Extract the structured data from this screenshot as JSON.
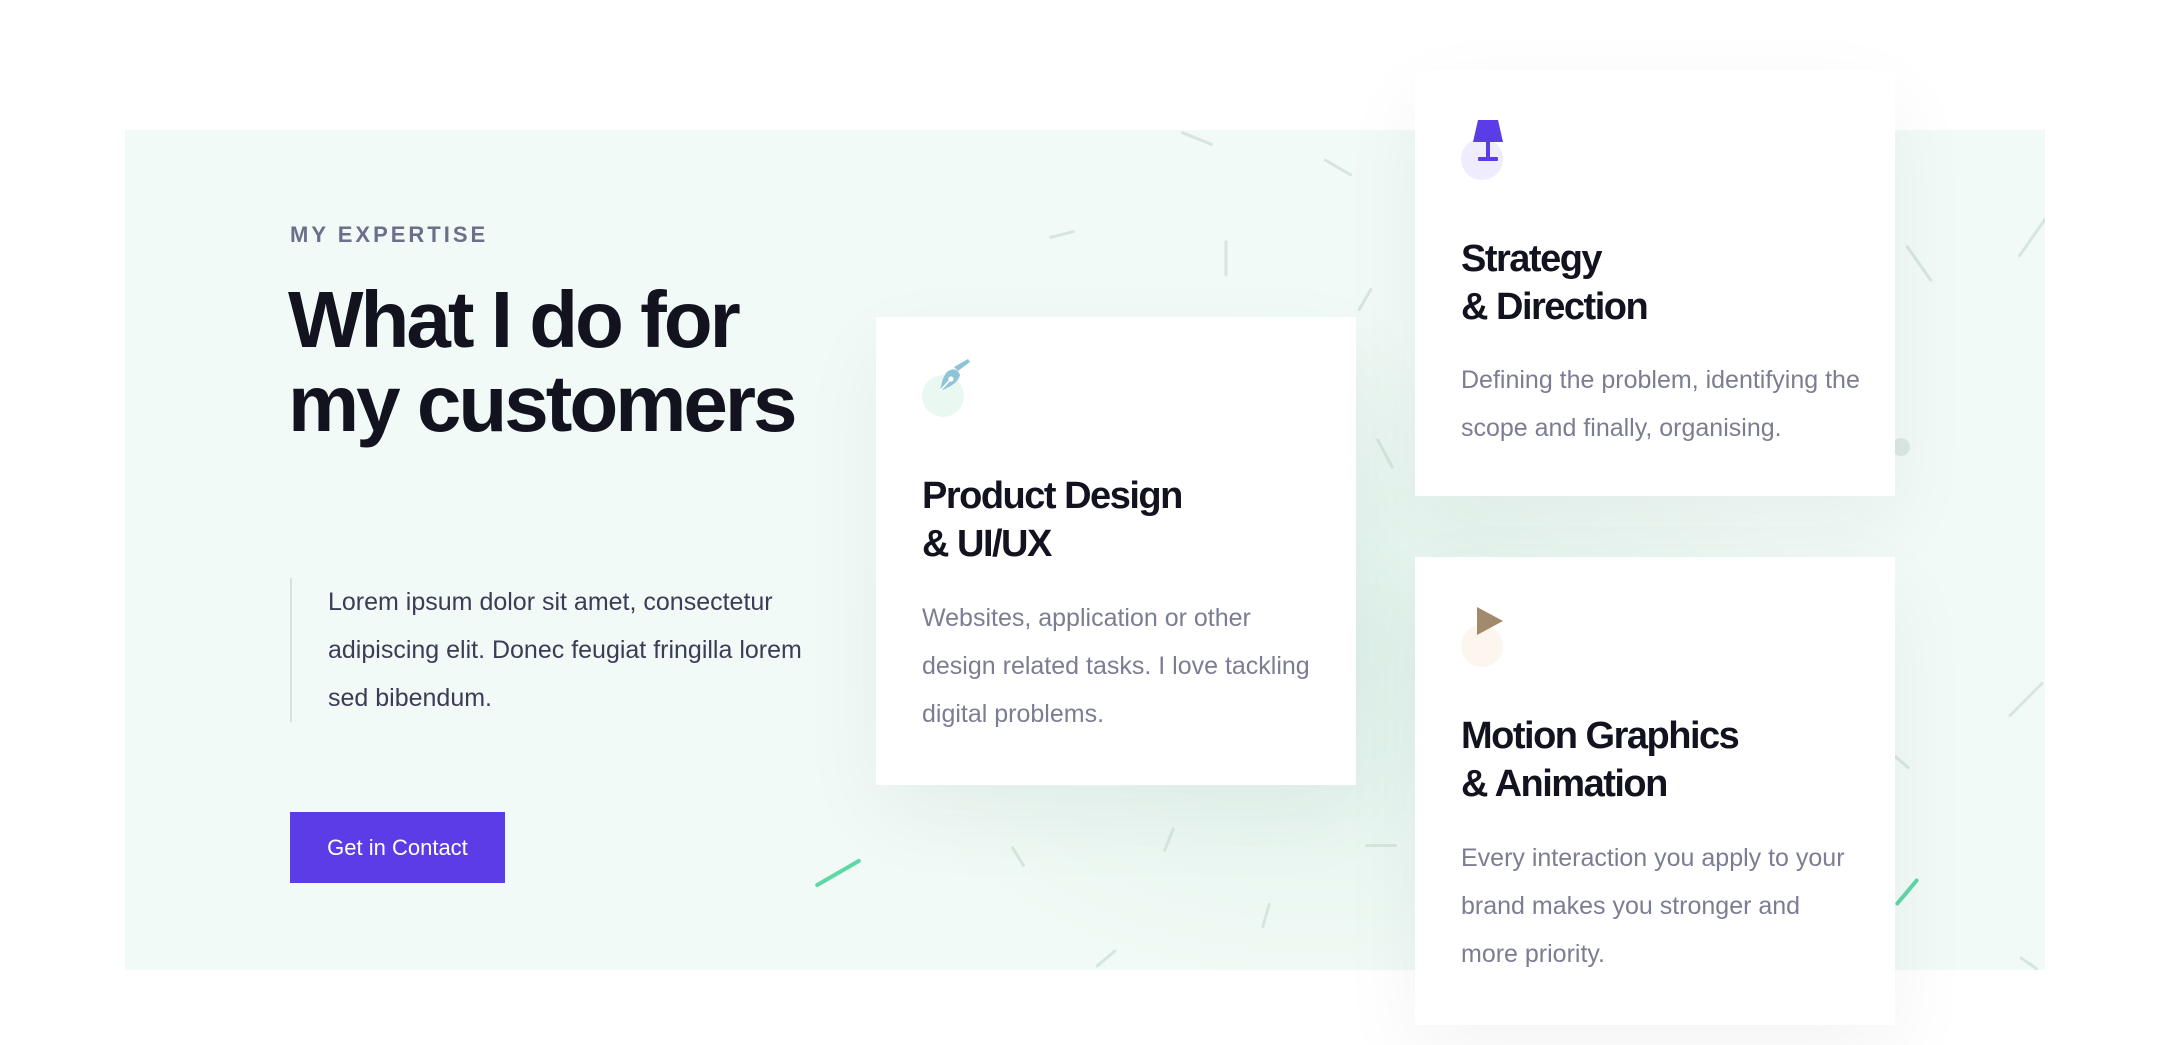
{
  "section": {
    "eyebrow": "MY EXPERTISE",
    "headline": "What I do for my customers",
    "intro": "Lorem ipsum dolor sit amet, consectetur adipiscing elit. Donec feugiat fringilla lorem sed bibendum.",
    "cta_label": "Get in Contact"
  },
  "cards": [
    {
      "icon": "pen-nib-icon",
      "icon_color": "#8ec4d6",
      "circle_color": "#eaf8f2",
      "title": "Product Design\n& UI/UX",
      "text": "Websites, application or other design related tasks. I love tackling digital problems."
    },
    {
      "icon": "lamp-icon",
      "icon_color": "#5b3ce6",
      "circle_color": "#efedfd",
      "title": "Strategy\n& Direction",
      "text": "Defining the problem, identifying the scope and finally, organising."
    },
    {
      "icon": "play-icon",
      "icon_color": "#a48a6c",
      "circle_color": "#fdf6ee",
      "title": "Motion Graphics\n& Animation",
      "text": "Every interaction you apply to your brand makes you stronger and more priority."
    }
  ],
  "colors": {
    "accent": "#5b3ce6",
    "panel_background": "#f1faf6",
    "heading": "#12131f",
    "body_text": "#7b7e93",
    "decor_green": "#5fd7a8"
  }
}
